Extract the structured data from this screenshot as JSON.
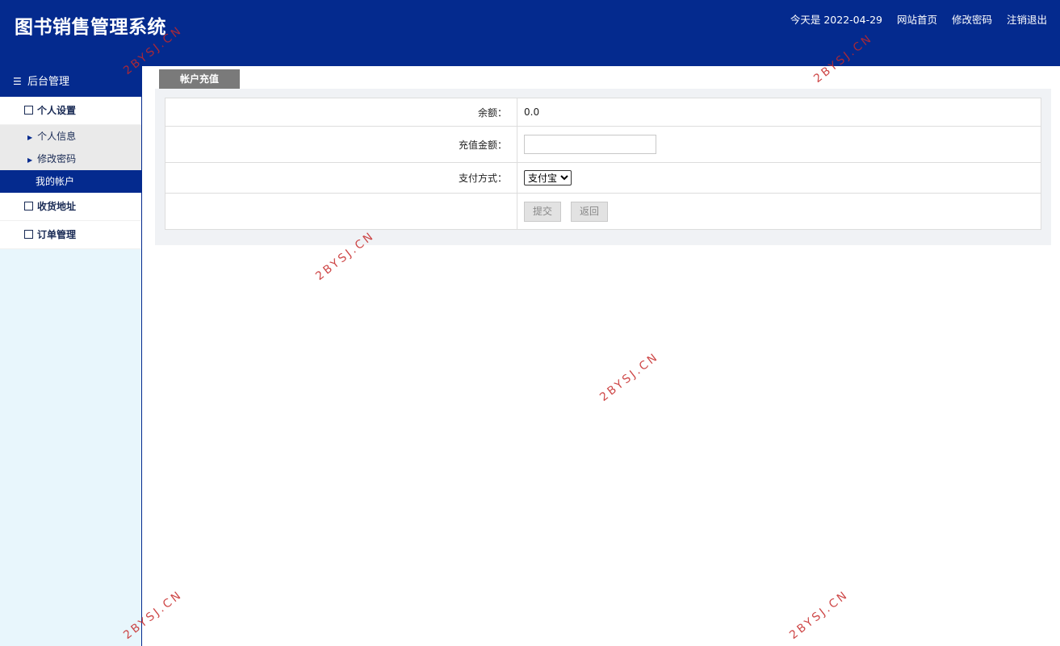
{
  "header": {
    "title": "图书销售管理系统",
    "date_text": "今天是 2022-04-29",
    "links": [
      "网站首页",
      "修改密码",
      "注销退出"
    ]
  },
  "sidebar": {
    "title": "后台管理",
    "groups": [
      {
        "label": "个人设置",
        "items": [
          "个人信息",
          "修改密码",
          "我的帐户"
        ]
      },
      {
        "label": "收货地址"
      },
      {
        "label": "订单管理"
      }
    ],
    "active_item": "我的帐户"
  },
  "main": {
    "tab_label": "帐户充值",
    "form": {
      "balance_label": "余额：",
      "balance_value": "0.0",
      "amount_label": "充值金额：",
      "amount_value": "",
      "payment_label": "支付方式：",
      "payment_selected": "支付宝",
      "submit_label": "提交",
      "back_label": "返回"
    }
  },
  "watermark": "2BYSJ.CN",
  "colors": {
    "primary": "#042a8e",
    "sidebar_bg": "#e8f6fc",
    "tab_bg": "#7a7a7a",
    "watermark": "#c62828"
  }
}
